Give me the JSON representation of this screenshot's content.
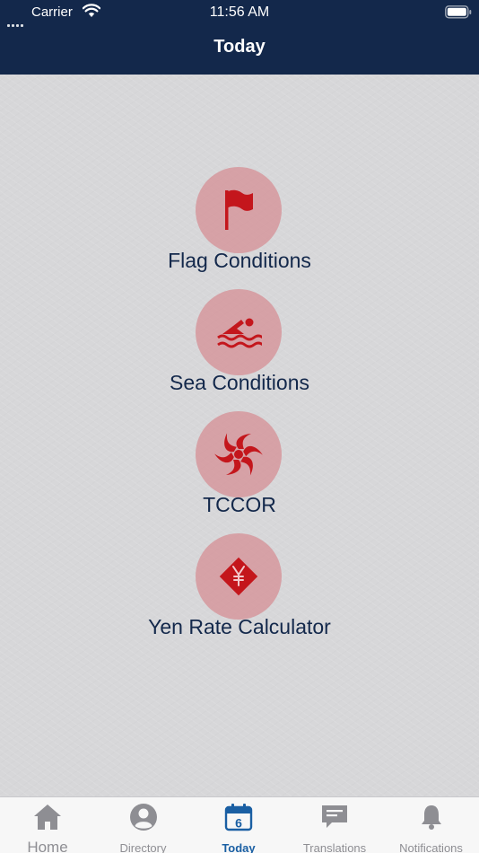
{
  "status_bar": {
    "carrier": "Carrier",
    "time": "11:56 AM"
  },
  "header": {
    "title": "Today"
  },
  "menu": [
    {
      "label": "Flag Conditions",
      "icon": "flag-icon"
    },
    {
      "label": "Sea Conditions",
      "icon": "swimmer-icon"
    },
    {
      "label": "TCCOR",
      "icon": "typhoon-icon"
    },
    {
      "label": "Yen Rate Calculator",
      "icon": "yen-icon"
    }
  ],
  "tabbar": {
    "tabs": [
      {
        "label": "Home",
        "icon": "home-icon"
      },
      {
        "label": "Directory",
        "icon": "person-icon"
      },
      {
        "label": "Today",
        "icon": "calendar-icon",
        "badge": "6"
      },
      {
        "label": "Translations",
        "icon": "chat-icon"
      },
      {
        "label": "Notifications",
        "icon": "bell-icon"
      }
    ],
    "active": "Today"
  },
  "colors": {
    "header_bg": "#13284b",
    "icon_red": "#c4161c",
    "circle_pink": "#d68c92",
    "label_navy": "#13284b",
    "tab_active": "#1a5fa3",
    "tab_inactive": "#8e8e93"
  }
}
